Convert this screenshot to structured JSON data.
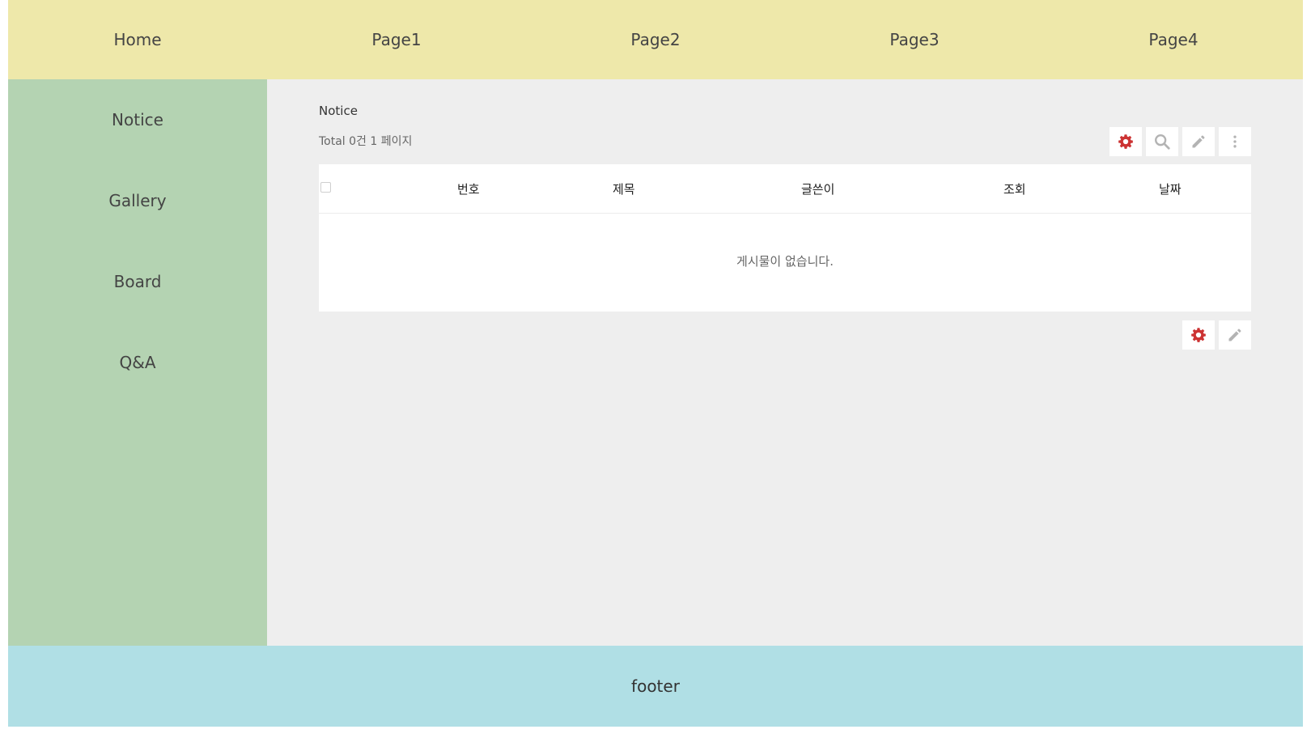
{
  "topnav": {
    "items": [
      {
        "label": "Home"
      },
      {
        "label": "Page1"
      },
      {
        "label": "Page2"
      },
      {
        "label": "Page3"
      },
      {
        "label": "Page4"
      }
    ]
  },
  "sidebar": {
    "items": [
      {
        "label": "Notice"
      },
      {
        "label": "Gallery"
      },
      {
        "label": "Board"
      },
      {
        "label": "Q&A"
      }
    ]
  },
  "board": {
    "title": "Notice",
    "total": "Total 0건 1 페이지",
    "columns": {
      "num": "번호",
      "subject": "제목",
      "writer": "글쓴이",
      "views": "조회",
      "date": "날짜"
    },
    "empty_message": "게시물이 없습니다.",
    "top_buttons": [
      "gear-icon",
      "search-icon",
      "pencil-icon",
      "more-vertical-icon"
    ],
    "bottom_buttons": [
      "gear-icon",
      "pencil-icon"
    ]
  },
  "colors": {
    "topnav_bg": "#eee8aa",
    "sidebar_bg": "#b4d3b2",
    "content_bg": "#eeeeee",
    "footer_bg": "#b0dfe5",
    "gear_icon": "#cc3333",
    "muted_icon": "#b3b3b3"
  },
  "footer": {
    "label": "footer"
  }
}
